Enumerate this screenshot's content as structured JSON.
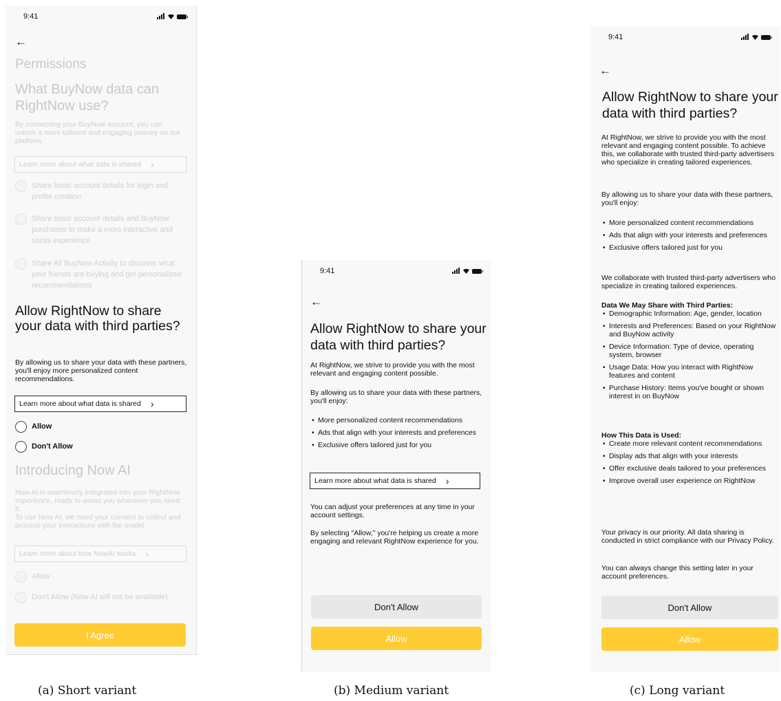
{
  "time": "9:41",
  "back_icon": "←",
  "captions": {
    "a": "(a) Short variant",
    "b": "(b) Medium variant",
    "c": "(c) Long variant"
  },
  "short": {
    "permissions_title": "Permissions",
    "buynow_title": "What BuyNow data can RightNow use?",
    "buynow_body": "By connecting your BuyNow account, you can unlock a more tailored and engaging journey on our platform.",
    "buynow_learn": "Learn more about what data is shared",
    "buynow_options": [
      "Share basic account details for login and profile creation",
      "Share basic account details and BuyNow purchases to make a more interactive and social experience",
      "Share All BuyNow Activity to discover what your friends are buying and get personalized recommendations"
    ],
    "share_title": "Allow RightNow to share your data with third parties?",
    "share_body": "By allowing us to share your data with these partners, you'll enjoy more personalized content recommendations.",
    "share_learn": "Learn more about what data is shared",
    "share_allow": "Allow",
    "share_dont": "Don't Allow",
    "ai_title": "Introducing Now AI",
    "ai_body": "Now AI is seamlessly integrated into your RightNow experience, ready to assist you whenever you need it.\nTo use Now AI, we need your consent to collect and process your interactions with the model.",
    "ai_learn": "Learn more about how NowAI works",
    "ai_allow": "Allow",
    "ai_dont": "Don't Allow (Now AI will not be available)",
    "agree": "I Agree"
  },
  "medium": {
    "title": "Allow RightNow to share your data with third parties?",
    "intro": "At RightNow, we strive to provide you with the most relevant and engaging content possible.",
    "enjoy": "By allowing us to share your data with these partners, you'll enjoy:",
    "bullets": [
      "More personalized content recommendations",
      "Ads that align with your interests and preferences",
      "Exclusive offers tailored just for you"
    ],
    "learn": "Learn more about what data is shared",
    "adjust": "You can adjust your preferences at any time in your account settings.",
    "selecting": "By selecting \"Allow,\" you're helping us create a more engaging and relevant RightNow experience for you.",
    "dont": "Don't Allow",
    "allow": "Allow"
  },
  "long": {
    "title": "Allow RightNow to share your data with third parties?",
    "intro": "At RightNow, we strive to provide you with the most relevant and engaging content possible. To achieve this, we collaborate with trusted third-party advertisers who specialize in creating tailored experiences.",
    "enjoy": "By allowing us to share your data with these partners, you'll enjoy:",
    "bullets": [
      "More personalized content recommendations",
      "Ads that align with your interests and preferences",
      "Exclusive offers tailored just for you"
    ],
    "collab": "We collaborate with trusted third-party advertisers who specialize in creating tailored experiences.",
    "data_heading": "Data We May Share with Third Parties:",
    "data_items": [
      "Demographic Information: Age, gender, location",
      "Interests and Preferences: Based on your RightNow and BuyNow activity",
      "Device Information: Type of device, operating system, browser",
      "Usage Data: How you interact with RightNow features and content",
      "Purchase History: Items you've bought or shown interest in on BuyNow"
    ],
    "use_heading": "How This Data is Used:",
    "use_items": [
      "Create more relevant content recommendations",
      "Display ads that align with your interests",
      "Offer exclusive deals tailored to your preferences",
      "Improve overall user experience on RightNow"
    ],
    "privacy": "Your privacy is our priority. All data sharing is conducted in strict compliance with our Privacy Policy.",
    "change": "You can always change this setting later in your account preferences.",
    "dont": "Don't Allow",
    "allow": "Allow"
  }
}
